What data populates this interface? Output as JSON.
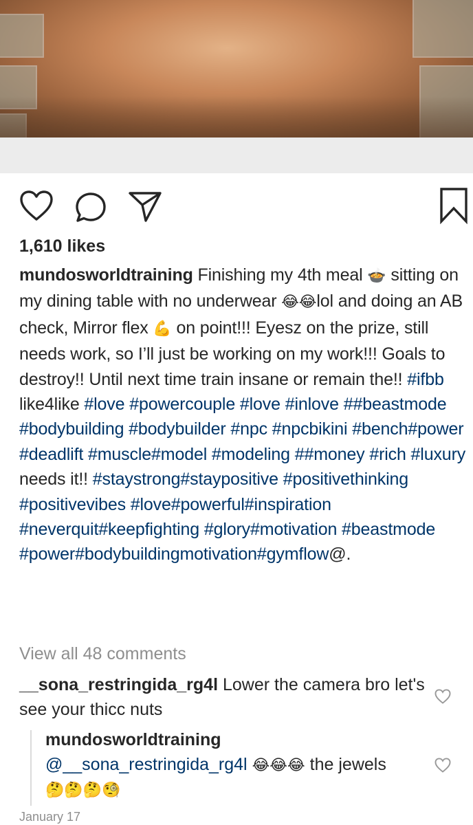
{
  "post": {
    "likes_text": "1,610 likes",
    "username": "mundosworldtraining",
    "caption_segments": [
      {
        "t": "Finishing my 4th meal ",
        "tag": false
      },
      {
        "t": "🍲",
        "emoji": true
      },
      {
        "t": " sitting on my dining table with no underwear ",
        "tag": false
      },
      {
        "t": "😂😂",
        "emoji": true
      },
      {
        "t": "lol and doing an AB check, Mirror flex ",
        "tag": false
      },
      {
        "t": "💪",
        "emoji": true
      },
      {
        "t": " on point!!! Eyesz on the prize, still needs work, so I’ll just be working on my work!!! Goals to destroy!! Until next time train insane or remain the!! ",
        "tag": false
      },
      {
        "t": "#ifbb",
        "tag": true
      },
      {
        "t": " like4like ",
        "tag": false
      },
      {
        "t": "#love",
        "tag": true
      },
      {
        "t": " ",
        "tag": false
      },
      {
        "t": "#powercouple",
        "tag": true
      },
      {
        "t": "  ",
        "tag": false
      },
      {
        "t": "#love",
        "tag": true
      },
      {
        "t": " ",
        "tag": false
      },
      {
        "t": "#inlove",
        "tag": true
      },
      {
        "t": " ",
        "tag": false
      },
      {
        "t": "##beastmode",
        "tag": true
      },
      {
        "t": " ",
        "tag": false
      },
      {
        "t": "#bodybuilding",
        "tag": true
      },
      {
        "t": " ",
        "tag": false
      },
      {
        "t": "#bodybuilder",
        "tag": true
      },
      {
        "t": " ",
        "tag": false
      },
      {
        "t": "#npc",
        "tag": true
      },
      {
        "t": " ",
        "tag": false
      },
      {
        "t": "#npcbikini",
        "tag": true
      },
      {
        "t": " ",
        "tag": false
      },
      {
        "t": "#bench#power",
        "tag": true
      },
      {
        "t": " ",
        "tag": false
      },
      {
        "t": "#deadlift",
        "tag": true
      },
      {
        "t": " ",
        "tag": false
      },
      {
        "t": "#muscle#model",
        "tag": true
      },
      {
        "t": " ",
        "tag": false
      },
      {
        "t": "#modeling",
        "tag": true
      },
      {
        "t": " ",
        "tag": false
      },
      {
        "t": "##money",
        "tag": true
      },
      {
        "t": " ",
        "tag": false
      },
      {
        "t": "#rich",
        "tag": true
      },
      {
        "t": " ",
        "tag": false
      },
      {
        "t": "#luxury",
        "tag": true
      },
      {
        "t": " needs it!! ",
        "tag": false
      },
      {
        "t": "#staystrong#staypositive",
        "tag": true
      },
      {
        "t": " ",
        "tag": false
      },
      {
        "t": "#positivethinking",
        "tag": true
      },
      {
        "t": " ",
        "tag": false
      },
      {
        "t": "#positivevibes",
        "tag": true
      },
      {
        "t": " ",
        "tag": false
      },
      {
        "t": "#love#powerful#inspiration",
        "tag": true
      },
      {
        "t": " ",
        "tag": false
      },
      {
        "t": "#neverquit#keepfighting",
        "tag": true
      },
      {
        "t": " ",
        "tag": false
      },
      {
        "t": "#glory#motivation",
        "tag": true
      },
      {
        "t": " ",
        "tag": false
      },
      {
        "t": "#beastmode",
        "tag": true
      },
      {
        "t": " ",
        "tag": false
      },
      {
        "t": "#power#bodybuildingmotivation#gymflow",
        "tag": true
      },
      {
        "t": "@.",
        "tag": false
      }
    ],
    "view_all_comments": "View all 48 comments",
    "date": "January 17"
  },
  "comments": [
    {
      "username": "__sona_restringida_rg4l",
      "text": "Lower the camera bro let's see your thicc nuts"
    }
  ],
  "reply": {
    "username": "mundosworldtraining",
    "mention": "@__sona_restringida_rg4l",
    "emojis_1": "😂😂😂",
    "text": "the jewels",
    "emojis_2": "🤔🤔🤔🧐"
  },
  "icons": {
    "like": "heart-icon",
    "comment": "comment-bubble-icon",
    "share": "paper-plane-icon",
    "save": "bookmark-icon"
  },
  "colors": {
    "text": "#262626",
    "hashtag": "#003569",
    "muted": "#8e8e8e"
  }
}
